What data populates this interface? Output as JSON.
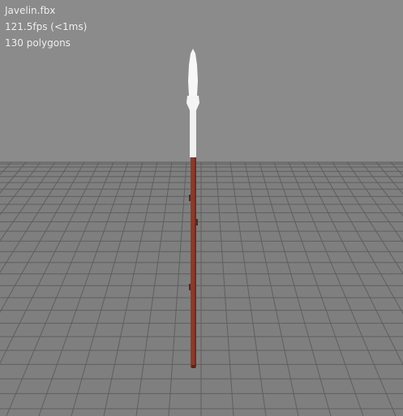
{
  "viewer": {
    "file_name": "Javelin.fbx",
    "fps_readout": "121.5fps (<1ms)",
    "polygon_count": "130 polygons"
  },
  "scene": {
    "model": "javelin",
    "colors": {
      "background": "#8b8b8b",
      "grid_line": "#5a5a5a",
      "grid_floor": "#7f7f7f",
      "shaft": "#8c3a2a",
      "tip": "#f2f2f2"
    }
  }
}
